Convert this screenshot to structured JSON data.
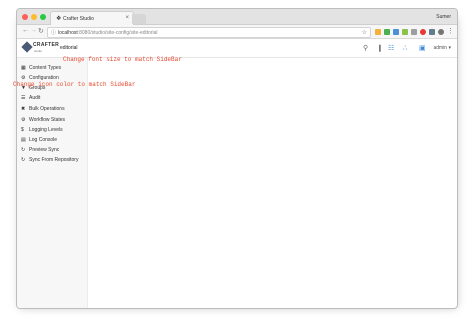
{
  "browser": {
    "tab_title": "Crafter Studio",
    "user_name": "Sumer",
    "url_host": "localhost",
    "url_path": ":8080/studio/site-config/site-editorial"
  },
  "app": {
    "site_name": "editorial",
    "logo_text": "CRAFTER",
    "logo_sub": "studio",
    "user_menu": "admin ▾"
  },
  "sidebar": {
    "items": [
      {
        "label": "Content Types",
        "icon": "grid-icon"
      },
      {
        "label": "Configuration",
        "icon": "gear-icon"
      },
      {
        "label": "Groups",
        "icon": "users-icon"
      },
      {
        "label": "Audit",
        "icon": "list-icon"
      },
      {
        "label": "Bulk Operations",
        "icon": "crosshair-icon"
      },
      {
        "label": "Workflow States",
        "icon": "gear-icon"
      },
      {
        "label": "Logging Levels",
        "icon": "dollar-icon"
      },
      {
        "label": "Log Console",
        "icon": "terminal-icon"
      },
      {
        "label": "Preview Sync",
        "icon": "refresh-icon"
      },
      {
        "label": "Sync From Repository",
        "icon": "refresh-icon"
      }
    ]
  },
  "annotations": {
    "font_note": "Change font size to match SideBar",
    "icon_note": "Change icon color to match SideBar"
  },
  "colors": {
    "annotation": "#e64a2e",
    "accent": "#3d8ad7"
  }
}
